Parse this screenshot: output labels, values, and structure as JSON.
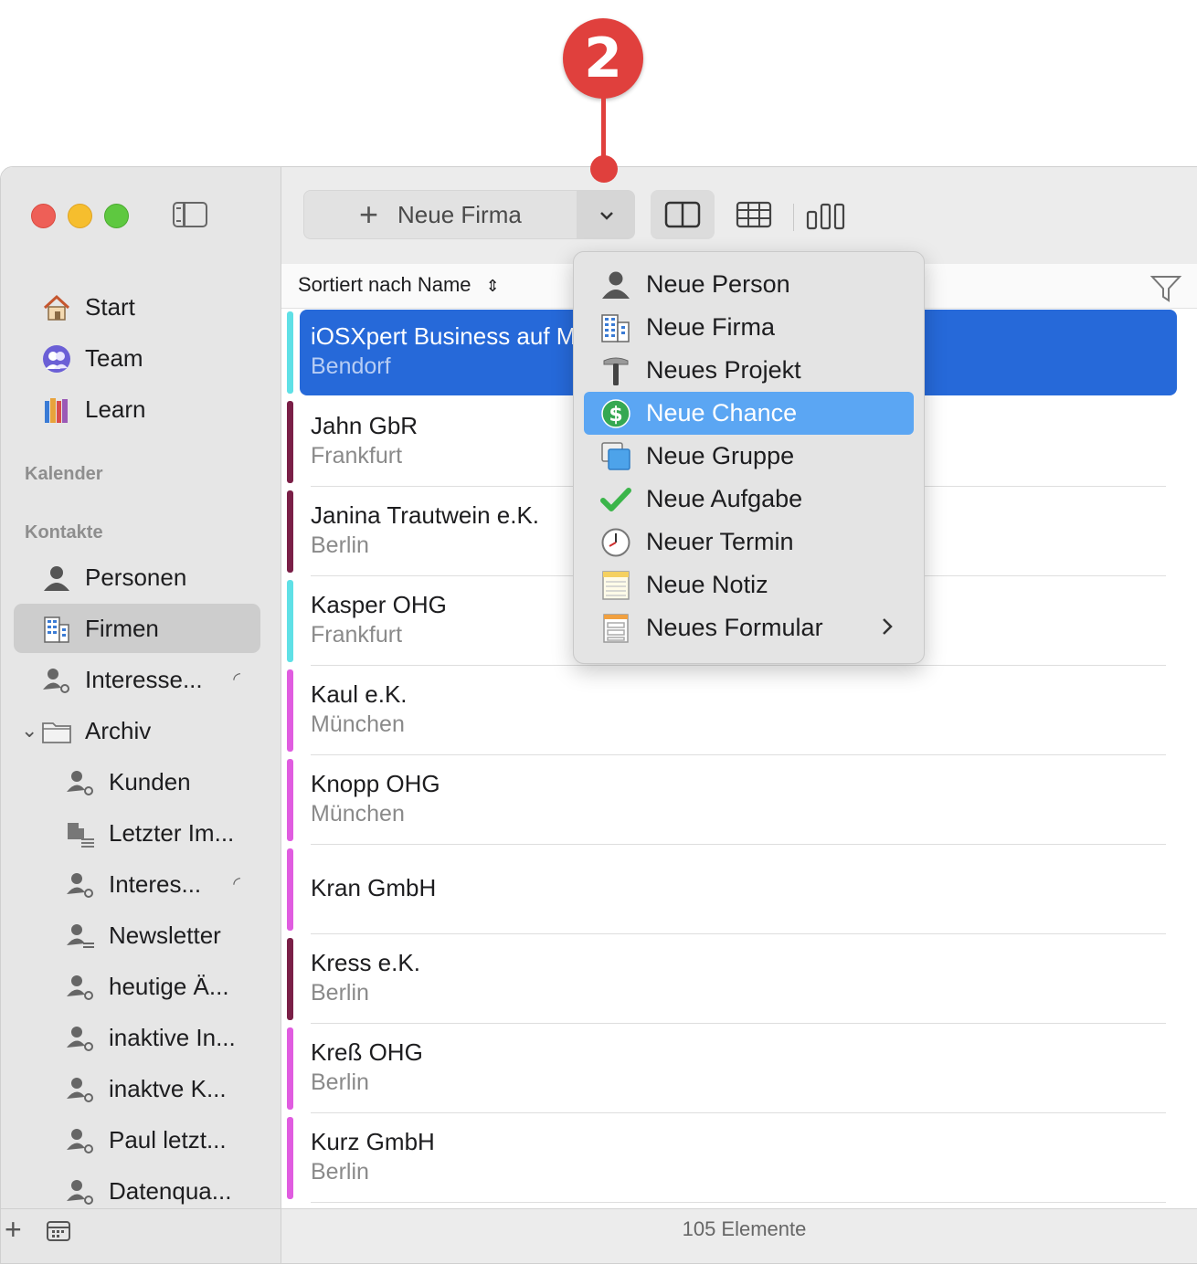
{
  "callout": {
    "number": "2"
  },
  "toolbar": {
    "new_button_label": "Neue Firma",
    "dropdown_icon": "chevron-down-icon",
    "views": [
      "split-view-icon",
      "table-view-icon",
      "kanban-view-icon"
    ]
  },
  "sidebar": {
    "nav": [
      {
        "label": "Start",
        "icon": "house-icon"
      },
      {
        "label": "Team",
        "icon": "team-icon"
      },
      {
        "label": "Learn",
        "icon": "books-icon"
      }
    ],
    "section_calendar": "Kalender",
    "section_contacts": "Kontakte",
    "contacts": [
      {
        "label": "Personen",
        "icon": "person-icon"
      },
      {
        "label": "Firmen",
        "icon": "building-icon",
        "selected": true
      },
      {
        "label": "Interesse...",
        "icon": "smart-group-icon",
        "badge": "shared-icon"
      }
    ],
    "archive": {
      "label": "Archiv",
      "icon": "folder-icon"
    },
    "archive_items": [
      {
        "label": "Kunden",
        "icon": "smart-group-icon"
      },
      {
        "label": "Letzter Im...",
        "icon": "company-list-icon"
      },
      {
        "label": "Interes...",
        "icon": "smart-group-icon",
        "badge": "shared-icon"
      },
      {
        "label": "Newsletter",
        "icon": "person-list-icon"
      },
      {
        "label": "heutige Ä...",
        "icon": "smart-group-icon"
      },
      {
        "label": "inaktive In...",
        "icon": "smart-group-icon"
      },
      {
        "label": "inaktve K...",
        "icon": "smart-group-icon"
      },
      {
        "label": "Paul letzt...",
        "icon": "smart-group-icon"
      },
      {
        "label": "Datenqua...",
        "icon": "smart-group-icon"
      }
    ],
    "footer": {
      "add": "+",
      "calendar_icon": "calendar-icon"
    }
  },
  "list": {
    "sort_label": "Sortiert nach Name",
    "rows": [
      {
        "title": "iOSXpert Business auf M",
        "subtitle": "Bendorf",
        "color": "#5fe0e6",
        "selected": true
      },
      {
        "title": "Jahn GbR",
        "subtitle": "Frankfurt",
        "color": "#7a1f47"
      },
      {
        "title": "Janina Trautwein e.K.",
        "subtitle": "Berlin",
        "color": "#7a1f47"
      },
      {
        "title": "Kasper OHG",
        "subtitle": "Frankfurt",
        "color": "#5fe0e6"
      },
      {
        "title": "Kaul e.K.",
        "subtitle": "München",
        "color": "#e05ce0"
      },
      {
        "title": "Knopp OHG",
        "subtitle": "München",
        "color": "#e05ce0"
      },
      {
        "title": "Kran GmbH",
        "subtitle": "",
        "color": "#e05ce0"
      },
      {
        "title": "Kress e.K.",
        "subtitle": "Berlin",
        "color": "#7a1f47"
      },
      {
        "title": "Kreß OHG",
        "subtitle": "Berlin",
        "color": "#e05ce0"
      },
      {
        "title": "Kurz GmbH",
        "subtitle": "Berlin",
        "color": "#e05ce0"
      }
    ],
    "status": "105 Elemente"
  },
  "menu": {
    "items": [
      {
        "label": "Neue Person",
        "icon": "person-icon"
      },
      {
        "label": "Neue Firma",
        "icon": "building-icon"
      },
      {
        "label": "Neues Projekt",
        "icon": "hammer-icon"
      },
      {
        "label": "Neue Chance",
        "icon": "dollar-icon",
        "highlighted": true
      },
      {
        "label": "Neue Gruppe",
        "icon": "group-icon"
      },
      {
        "label": "Neue Aufgabe",
        "icon": "checkmark-icon"
      },
      {
        "label": "Neuer Termin",
        "icon": "clock-icon"
      },
      {
        "label": "Neue Notiz",
        "icon": "note-icon"
      },
      {
        "label": "Neues Formular",
        "icon": "form-icon",
        "submenu": true
      }
    ]
  },
  "colors": {
    "accent": "#2669d9",
    "menu_highlight": "#5ba6f3",
    "callout": "#e0403d"
  }
}
